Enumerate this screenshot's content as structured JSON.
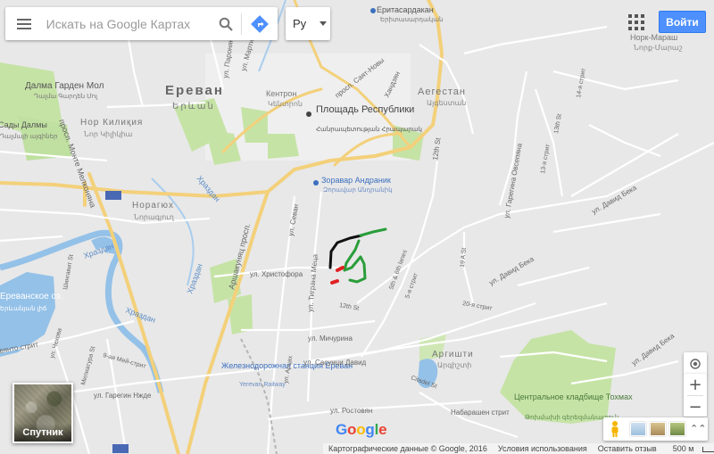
{
  "search": {
    "placeholder": "Искать на Google Картах"
  },
  "language": {
    "selected": "Ру"
  },
  "account": {
    "signin_label": "Войти"
  },
  "map": {
    "city": {
      "name": "Ереван",
      "name_native": "Երևան"
    },
    "districts": [
      {
        "ru": "Кентрон",
        "native": "Կենտրոն"
      },
      {
        "ru": "Аегестан",
        "native": "Այգեստան"
      },
      {
        "ru": "Нор Килиқия",
        "native": "Նոր Կիլիկիա"
      },
      {
        "ru": "Норагюх",
        "native": "Նորագյուղ"
      },
      {
        "ru": "Норк-Мараш",
        "native": "Նորք-Մարաշ"
      },
      {
        "ru": "Аргишти",
        "native": "Արգիշտի"
      }
    ],
    "places": [
      {
        "ru": "Площадь Республики",
        "native": "Հանրապետության Հրապարակ"
      },
      {
        "ru": "Еритасардакан",
        "native": "Երիտասարդական"
      },
      {
        "ru": "Зоравар Андраник",
        "native": "Զորավար Անդրանիկ"
      },
      {
        "ru": "Далма Гарден Мол",
        "native": "Դալմա Գարդեն Մոլ"
      },
      {
        "ru": "Сады Далмы",
        "native": "Դալմայի այգիներ"
      },
      {
        "ru": "Ереванское оз.",
        "native": "Երևանյան լիճ"
      },
      {
        "ru": "Железнодорожная станция Ереван",
        "sub": "Yerevan Railway"
      },
      {
        "ru": "Центральное кладбище Тохмах",
        "native": "Թոխմախի գերեզմանատուն"
      }
    ],
    "streets": [
      "просп. Саят-Новы",
      "просп. Месропа Маштоца",
      "Хандзян",
      "ул. Паронян",
      "ул. Мартироса",
      "12th St",
      "просп. Монте Мелконяна",
      "М5",
      "Храздан",
      "ул. Тиграна Меца",
      "ул. Христофора",
      "Аршакуняц просп.",
      "ул. Севан",
      "12th St",
      "5th & 6th lanes",
      "5-я стрит",
      "20-я стрит",
      "ул. Давид Бека",
      "ул. Давид Бека",
      "ул. Гарегина Овсепяна",
      "19 A St",
      "13-я стрит",
      "13th St",
      "13-й стрит",
      "14-я стрит",
      "ул. Мичурина",
      "ул. Сасунци Давид",
      "ул. Ростовян",
      "ул. Чехова",
      "9-ая Мей-стрит",
      "Шингавит St",
      "Милиатура St",
      "ул. Гарегин Нжде",
      "ул. Арцах",
      "Набарашен стрит",
      "Citadel St",
      "ул. Давид Бека",
      "М2",
      "вянто-стрит"
    ]
  },
  "controls": {
    "satellite_label": "Спутник",
    "zoom_in": "+",
    "zoom_out": "−",
    "expand": "⌃⌃"
  },
  "footer": {
    "logo": "Google",
    "attribution": "Картографические данные © Google, 2016",
    "terms": "Условия использования",
    "feedback": "Оставить отзыв",
    "scale": "500 м"
  },
  "colors": {
    "route_black": "#111111",
    "route_green": "#2a9d3a",
    "route_red": "#e02020",
    "park": "#c6e3a6",
    "water": "#94c1e8",
    "highway": "#f3d07a",
    "signin": "#4d90fe"
  },
  "icons": [
    "menu-icon",
    "search-icon",
    "directions-icon",
    "apps-grid-icon",
    "locate-icon",
    "pegman-icon"
  ]
}
